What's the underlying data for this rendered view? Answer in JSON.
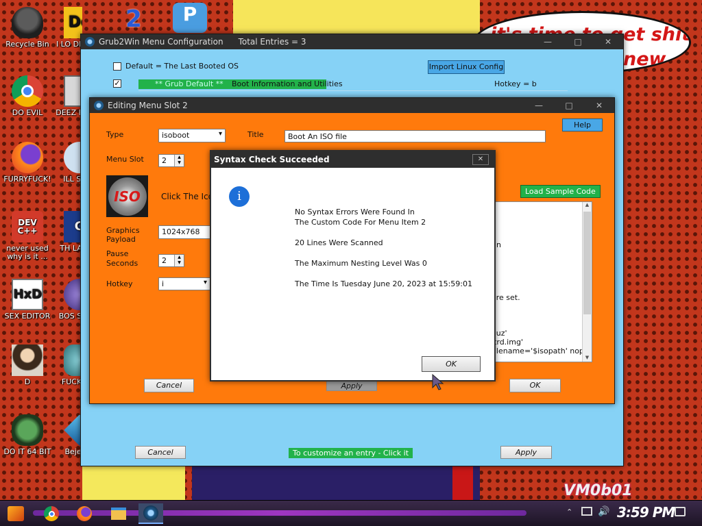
{
  "desktop": {
    "icons": [
      {
        "label": "Recycle Bin"
      },
      {
        "label": "I LO DETECT"
      },
      {
        "label": "DO EVIL"
      },
      {
        "label": "DEEZ HAH G"
      },
      {
        "label": "FURRYFUCK!"
      },
      {
        "label": "ILL SI YO"
      },
      {
        "label": "never used why is it ..."
      },
      {
        "label": "TH LANGU"
      },
      {
        "label": "SEX EDITOR"
      },
      {
        "label": "BOS SIMUL"
      },
      {
        "label": "D"
      },
      {
        "label": "FUCK ELV"
      },
      {
        "label": "DO IT 64 BIT"
      },
      {
        "label": "Beje DE"
      }
    ],
    "icon_glyphs": {
      "de": "De",
      "two": "2",
      "p": "P",
      "iso_logo": "ISO",
      "devcpp": "DEV C++",
      "hxd": "HxD",
      "g": "G"
    },
    "speech_bubble": {
      "line1": "it's time to get shit",
      "line2": "new"
    },
    "watermark": "VM0b01"
  },
  "main_window": {
    "title": "Grub2Win Menu Configuration",
    "total_entries": "Total Entries = 3",
    "default_checkbox_label": "Default = The Last Booted OS",
    "import_button": "Import Linux Config",
    "row_left": "** Grub Default **",
    "row_mid": "Boot Information and Utilities",
    "row_hotkey": "Hotkey = b",
    "cancel_button": "Cancel",
    "customize_hint": "To customize an entry - Click it",
    "apply_button": "Apply"
  },
  "edit_window": {
    "title": "Editing Menu Slot 2",
    "type_label": "Type",
    "type_value": "isoboot",
    "title_label": "Title",
    "title_value": "Boot An ISO file",
    "help_button": "Help",
    "menu_slot_label": "Menu Slot",
    "menu_slot_value": "2",
    "click_icon_text": "Click The Icon",
    "load_sample_button": "Load Sample Code",
    "graphics_label_1": "Graphics",
    "graphics_label_2": "Payload",
    "graphics_value": "1024x768",
    "pause_label_1": "Pause",
    "pause_label_2": "Seconds",
    "pause_value": "2",
    "hotkey_label": "Hotkey",
    "hotkey_value": "i",
    "code_fragments": [
      "n",
      "are set.",
      "auz'",
      "itrd.img'",
      "filename='$isopath' noprom"
    ],
    "cancel_button": "Cancel",
    "apply_button": "Apply",
    "ok_button": "OK"
  },
  "dialog": {
    "title": "Syntax Check Succeeded",
    "close_glyph": "✕",
    "info_glyph": "i",
    "lines": [
      "No Syntax Errors Were Found In",
      "The Custom Code For Menu Item 2",
      "20 Lines Were Scanned",
      "The Maximum Nesting Level Was 0",
      "The Time Is Tuesday  June 20, 2023  at  15:59:01"
    ],
    "ok_button": "OK"
  },
  "taskbar": {
    "clock": "3:59 PM"
  },
  "colors": {
    "main_bg": "#86d2f6",
    "edit_bg": "#ff7a0c",
    "green": "#22b24a",
    "blue_button": "#49a7e6",
    "title_bar": "#2e2e2e"
  }
}
